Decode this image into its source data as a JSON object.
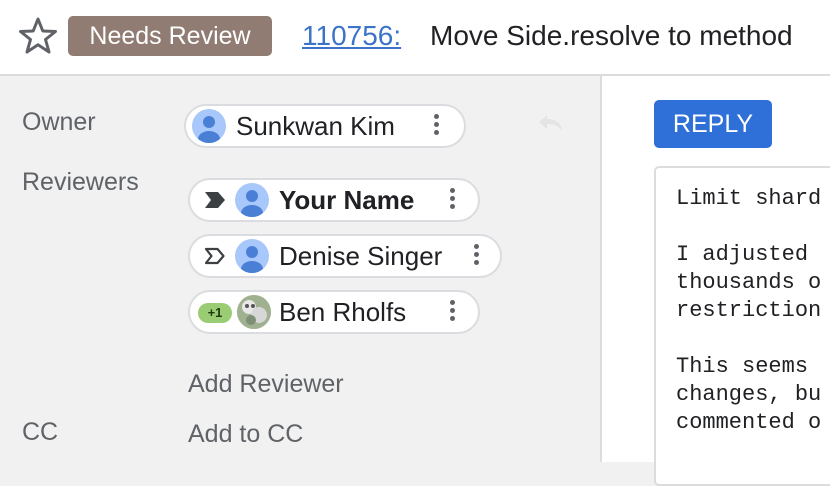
{
  "header": {
    "status": "Needs Review",
    "change_number": "110756:",
    "change_title": "Move Side.resolve to method"
  },
  "metadata": {
    "owner_label": "Owner",
    "reviewers_label": "Reviewers",
    "cc_label": "CC",
    "owner": {
      "name": "Sunkwan Kim"
    },
    "reviewers": [
      {
        "name": "Your Name",
        "marker": "attention-filled"
      },
      {
        "name": "Denise Singer",
        "marker": "attention-outline"
      },
      {
        "name": "Ben Rholfs",
        "vote": "+1"
      }
    ],
    "add_reviewer": "Add Reviewer",
    "add_cc": "Add to CC"
  },
  "reply": {
    "button_label": "REPLY"
  },
  "message": {
    "lines": [
      "Limit shard",
      "",
      "I adjusted",
      "thousands o",
      "restriction",
      "",
      "This seems",
      "changes, bu",
      "commented o"
    ]
  },
  "colors": {
    "status_chip": "#917c73",
    "link": "#3b73c9",
    "reply_button": "#2f6fd8",
    "vote_badge": "#9acc73",
    "avatar": "#a8c7fa"
  }
}
